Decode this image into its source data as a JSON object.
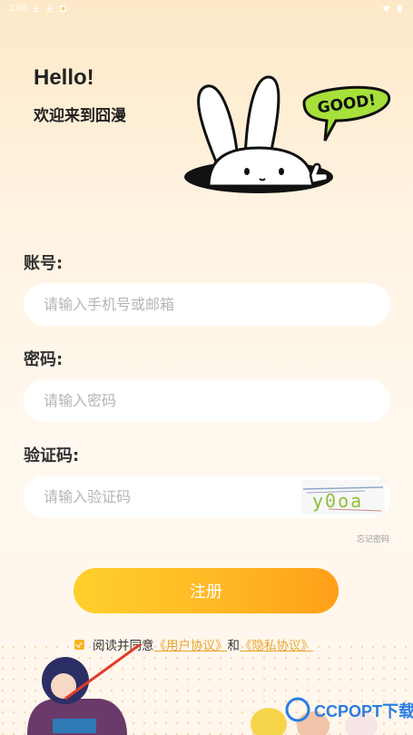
{
  "status_bar": {
    "time": "2:06"
  },
  "greeting": {
    "hello": "Hello!",
    "welcome": "欢迎来到囧漫"
  },
  "mascot": {
    "bubble_text": "GOOD!"
  },
  "form": {
    "account": {
      "label": "账号:",
      "placeholder": "请输入手机号或邮箱"
    },
    "password": {
      "label": "密码:",
      "placeholder": "请输入密码"
    },
    "captcha": {
      "label": "验证码:",
      "placeholder": "请输入验证码",
      "image_text": "y0oa"
    },
    "forgot_label": "忘记密码",
    "submit_label": "注册"
  },
  "agreement": {
    "prefix": "阅读并同意",
    "user_link": "《用户协议》",
    "joiner": "和",
    "privacy_link": "《隐私协议》"
  },
  "watermark": "CCPOPT下载"
}
